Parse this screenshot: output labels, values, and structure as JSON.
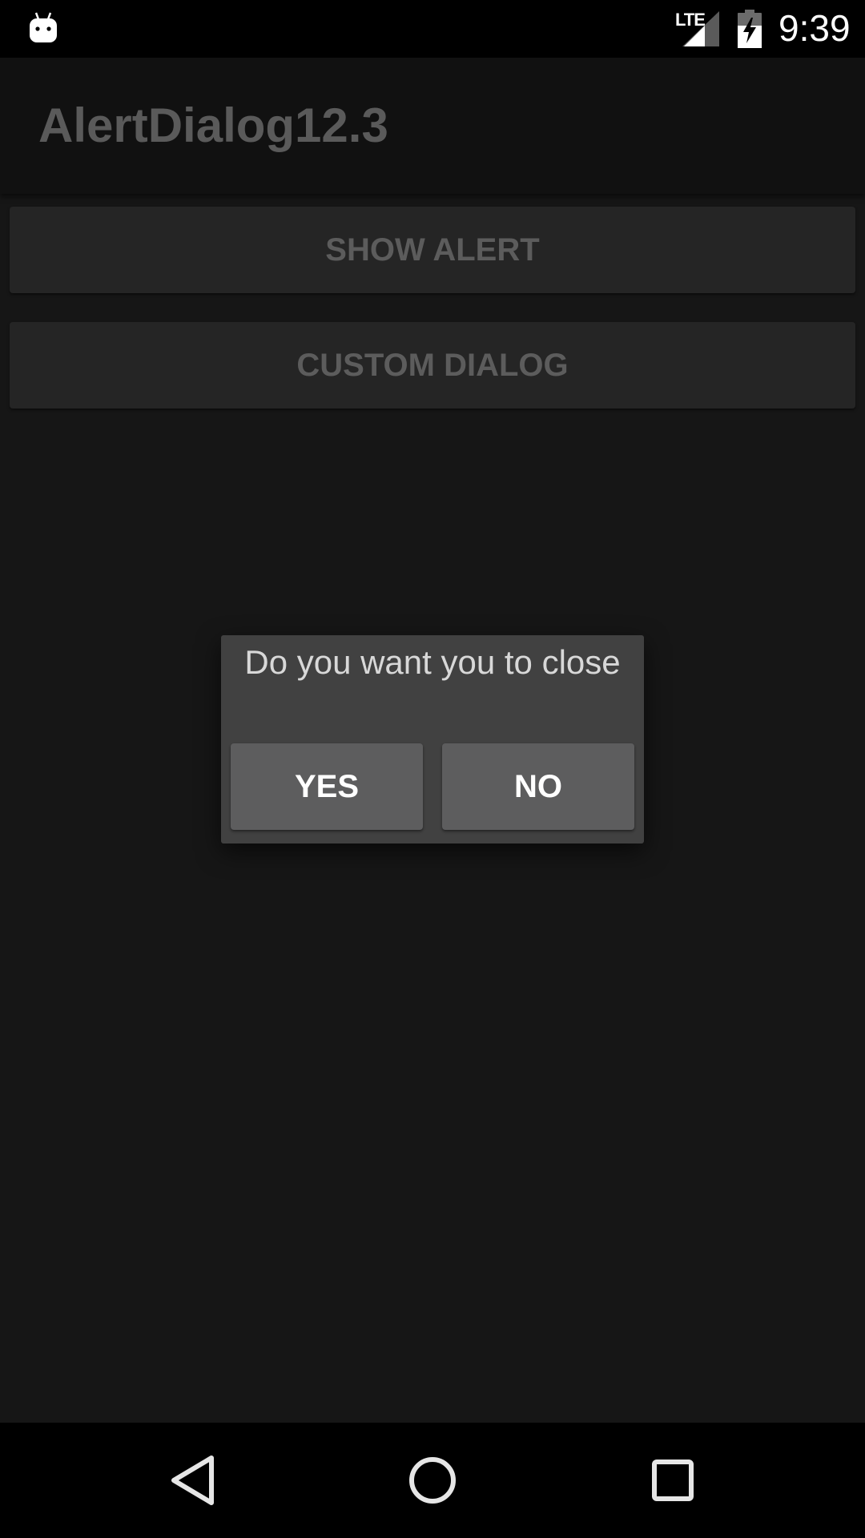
{
  "status_bar": {
    "network_label": "LTE",
    "time": "9:39",
    "icons": [
      "notification-android-icon",
      "signal-icon",
      "battery-charging-icon"
    ]
  },
  "app_bar": {
    "title": "AlertDialog12.3"
  },
  "main": {
    "show_alert_label": "SHOW ALERT",
    "custom_dialog_label": "CUSTOM DIALOG"
  },
  "dialog": {
    "message": "Do you want you to close",
    "yes_label": "YES",
    "no_label": "NO"
  },
  "nav_bar": {
    "icons": [
      "back-icon",
      "home-icon",
      "recents-icon"
    ]
  },
  "colors": {
    "background": "#161616",
    "app_bar": "#111111",
    "dialog": "#414141",
    "dialog_button": "#5d5d5e",
    "dimmed_text": "#5c5c5c"
  }
}
